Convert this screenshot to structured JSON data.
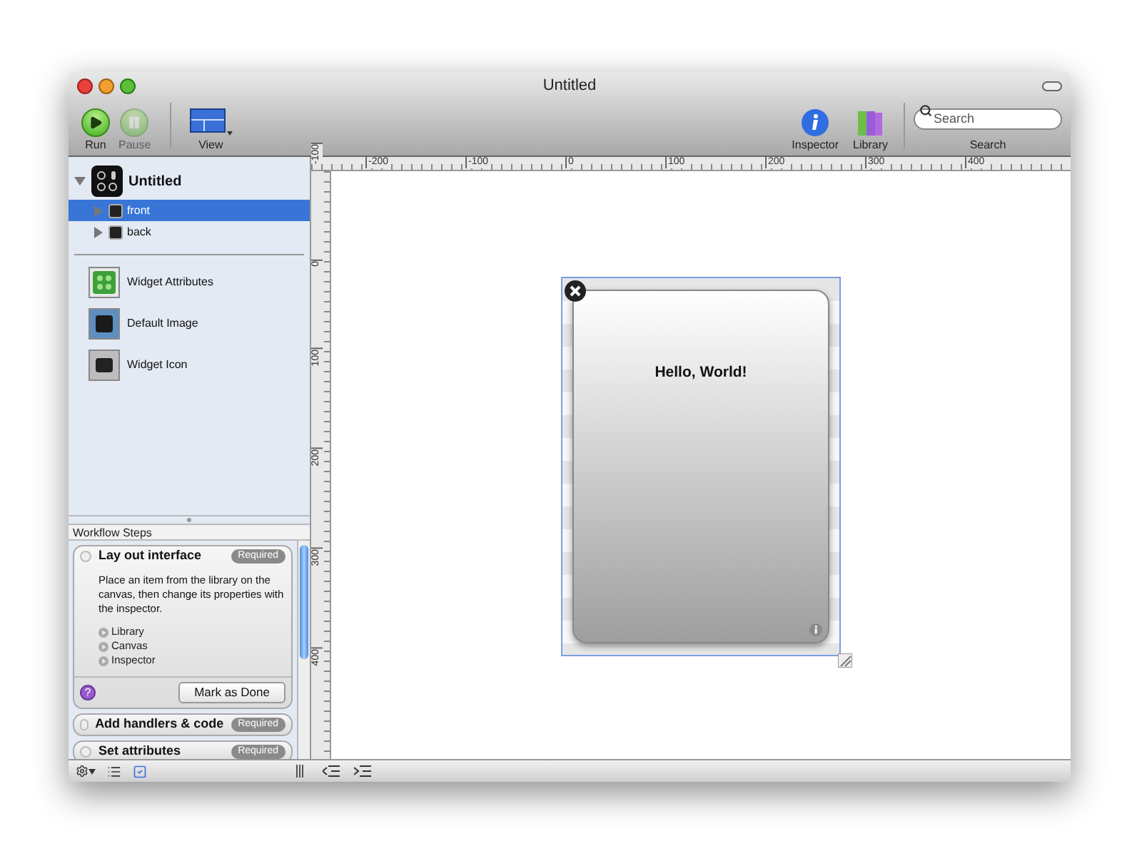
{
  "window": {
    "title": "Untitled"
  },
  "toolbar": {
    "left": [
      {
        "kind": "run",
        "label": "Run",
        "disabled": false
      },
      {
        "kind": "pause",
        "label": "Pause",
        "disabled": true
      },
      {
        "kind": "view",
        "label": "View",
        "disabled": false
      }
    ],
    "right": [
      {
        "kind": "inspector",
        "label": "Inspector"
      },
      {
        "kind": "library",
        "label": "Library"
      }
    ],
    "search": {
      "placeholder": "Search",
      "label": "Search"
    }
  },
  "sidebar": {
    "project": {
      "title": "Untitled",
      "expanded": true,
      "children": [
        {
          "label": "front",
          "selected": true,
          "expanded": false
        },
        {
          "label": "back",
          "selected": false,
          "expanded": false
        }
      ]
    },
    "settings": [
      {
        "kind": "attributes",
        "label": "Widget Attributes"
      },
      {
        "kind": "image",
        "label": "Default Image"
      },
      {
        "kind": "icon",
        "label": "Widget Icon"
      }
    ]
  },
  "workflow": {
    "title": "Workflow Steps",
    "steps": [
      {
        "title": "Lay out interface",
        "badge": "Required",
        "expanded": true,
        "description": "Place an item from the library on the canvas, then change its properties with the inspector.",
        "links": [
          "Library",
          "Canvas",
          "Inspector"
        ],
        "help": "?",
        "button": "Mark as Done"
      },
      {
        "title": "Add handlers & code",
        "badge": "Required",
        "expanded": false
      },
      {
        "title": "Set attributes",
        "badge": "Required",
        "expanded": false
      }
    ]
  },
  "rulers": {
    "horizontal": [
      "-200",
      "-100",
      "0",
      "100",
      "200",
      "300",
      "400"
    ],
    "vertical": [
      "-100",
      "0",
      "100",
      "200",
      "300",
      "400"
    ]
  },
  "canvas": {
    "widget": {
      "text": "Hello, World!",
      "selected": true
    }
  }
}
